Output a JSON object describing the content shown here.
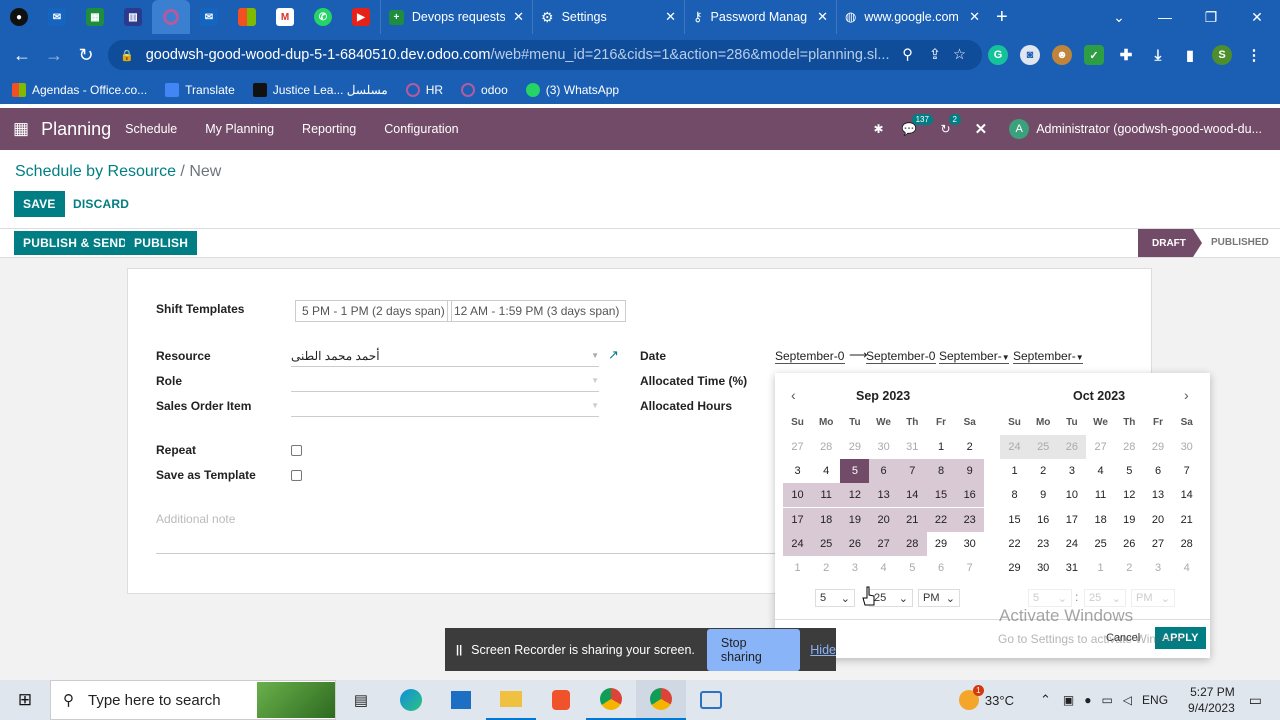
{
  "browser": {
    "tabs": [
      {
        "label": "Devops requests",
        "icon": "sheets-icon"
      },
      {
        "label": "Settings",
        "icon": "gear-icon"
      },
      {
        "label": "Password Manag",
        "icon": "key-icon"
      },
      {
        "label": "www.google.com",
        "icon": "globe-icon"
      }
    ],
    "url_host": "goodwsh-good-wood-dup-5-1-6840510.dev.odoo.com",
    "url_path": "/web#menu_id=216&cids=1&action=286&model=planning.sl...",
    "profile_initial": "S",
    "bookmarks": [
      "Agendas - Office.co...",
      "Translate",
      "Justice Lea... مسلسل",
      "HR",
      "odoo",
      "(3) WhatsApp"
    ]
  },
  "odoo": {
    "app_name": "Planning",
    "menu": [
      "Schedule",
      "My Planning",
      "Reporting",
      "Configuration"
    ],
    "messages_count": "137",
    "activities_count": "2",
    "user_initial": "A",
    "user_name": "Administrator (goodwsh-good-wood-du..."
  },
  "breadcrumb": {
    "parent": "Schedule by Resource",
    "sep": " / ",
    "current": "New"
  },
  "buttons": {
    "save": "SAVE",
    "discard": "DISCARD",
    "publish_send": "PUBLISH & SEND",
    "publish": "PUBLISH"
  },
  "status": {
    "draft": "DRAFT",
    "published": "PUBLISHED"
  },
  "form": {
    "shift_templates_label": "Shift Templates",
    "templates": [
      "5 PM - 1 PM (2 days span)",
      "12 AM - 1:59 PM (3 days span)"
    ],
    "resource_label": "Resource",
    "resource_value": "أحمد محمد الطنى",
    "role_label": "Role",
    "sales_order_label": "Sales Order Item",
    "repeat_label": "Repeat",
    "save_template_label": "Save as Template",
    "note_placeholder": "Additional note",
    "date_label": "Date",
    "date_start": "September-0",
    "date_end": "September-0",
    "date_start2": "September-",
    "date_end2": "September-",
    "allocated_time_label": "Allocated Time (%)",
    "allocated_hours_label": "Allocated Hours"
  },
  "datepicker": {
    "weekdays": [
      "Su",
      "Mo",
      "Tu",
      "We",
      "Th",
      "Fr",
      "Sa"
    ],
    "left_month": "Sep 2023",
    "right_month": "Oct 2023",
    "left_days": [
      "27",
      "28",
      "29",
      "30",
      "31",
      "1",
      "2",
      "3",
      "4",
      "5",
      "6",
      "7",
      "8",
      "9",
      "10",
      "11",
      "12",
      "13",
      "14",
      "15",
      "16",
      "17",
      "18",
      "19",
      "20",
      "21",
      "22",
      "23",
      "24",
      "25",
      "26",
      "27",
      "28",
      "29",
      "30",
      "1",
      "2",
      "3",
      "4",
      "5",
      "6",
      "7"
    ],
    "right_days": [
      "24",
      "25",
      "26",
      "27",
      "28",
      "29",
      "30",
      "1",
      "2",
      "3",
      "4",
      "5",
      "6",
      "7",
      "8",
      "9",
      "10",
      "11",
      "12",
      "13",
      "14",
      "15",
      "16",
      "17",
      "18",
      "19",
      "20",
      "21",
      "22",
      "23",
      "24",
      "25",
      "26",
      "27",
      "28",
      "29",
      "30",
      "31",
      "1",
      "2",
      "3",
      "4"
    ],
    "hour": "5",
    "minute": "25",
    "ampm": "PM",
    "hour2": "5",
    "minute2": "25",
    "ampm2": "PM",
    "time_sep": ":",
    "cancel": "Cancel",
    "apply": "APPLY"
  },
  "watermark": {
    "title": "Activate Windows",
    "subtitle": "Go to Settings to activate Windows."
  },
  "screen_share": {
    "text": "Screen Recorder is sharing your screen.",
    "stop": "Stop sharing",
    "hide": "Hide"
  },
  "taskbar": {
    "search_placeholder": "Type here to search",
    "temperature": "33°C",
    "weather_badge": "1",
    "language": "ENG",
    "time": "5:27 PM",
    "date": "9/4/2023"
  }
}
